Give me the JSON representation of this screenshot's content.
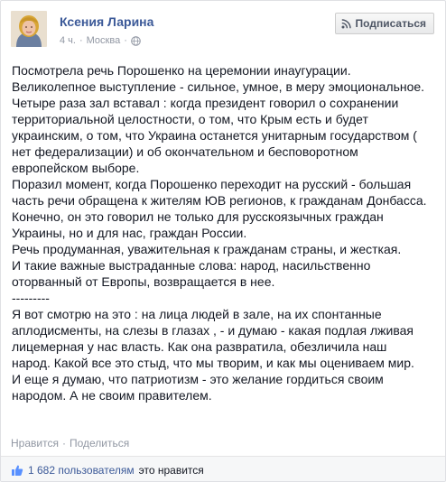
{
  "post": {
    "author": "Ксения Ларина",
    "time": "4 ч.",
    "separator": "·",
    "location": "Москва",
    "subscribe_label": "Подписаться",
    "body_lines": [
      "Посмотрела речь Порошенко на церемонии инаугурации.",
      "Великолепное выступление - сильное, умное, в меру эмоциональное.",
      "Четыре раза зал вставал : когда президент говорил о сохранении",
      "территориальной целостности, о том, что Крым есть и будет",
      "украинским, о том, что Украина останется унитарным государством (",
      "нет федерализации) и об окончательном и бесповоротном",
      "европейском выборе.",
      "Поразил момент, когда Порошенко переходит на русский - большая",
      "часть речи обращена к жителям ЮВ регионов, к гражданам Донбасса.",
      "Конечно, он это говорил не только для русскоязычных граждан",
      "Украины, но и для нас, граждан России.",
      "Речь продуманная, уважительная к гражданам страны, и жесткая.",
      "И такие важные выстраданные слова: народ, насильственно",
      "оторванный от Европы, возвращается в нее.",
      "---------",
      "Я вот смотрю на это : на лица людей в зале, на их спонтанные",
      "аплодисменты, на слезы в глазах , - и думаю - какая подлая лживая",
      "лицемерная у нас власть. Как она развратила, обезличила наш",
      "народ. Какой все это стыд, что мы творим, и как мы оцениваем мир.",
      "И еще я думаю, что патриотизм - это желание гордиться своим",
      "народом. А не своим правителем."
    ]
  },
  "actions": {
    "like": "Нравится",
    "separator": "·",
    "share": "Поделиться"
  },
  "likes": {
    "count": "1 682 пользователям",
    "suffix": "это нравится"
  },
  "colors": {
    "link": "#3b5998",
    "meta": "#9197a3",
    "text": "#141823"
  },
  "icons": {
    "globe": "globe-icon",
    "rss": "rss-icon",
    "thumb": "thumbs-up-icon"
  }
}
